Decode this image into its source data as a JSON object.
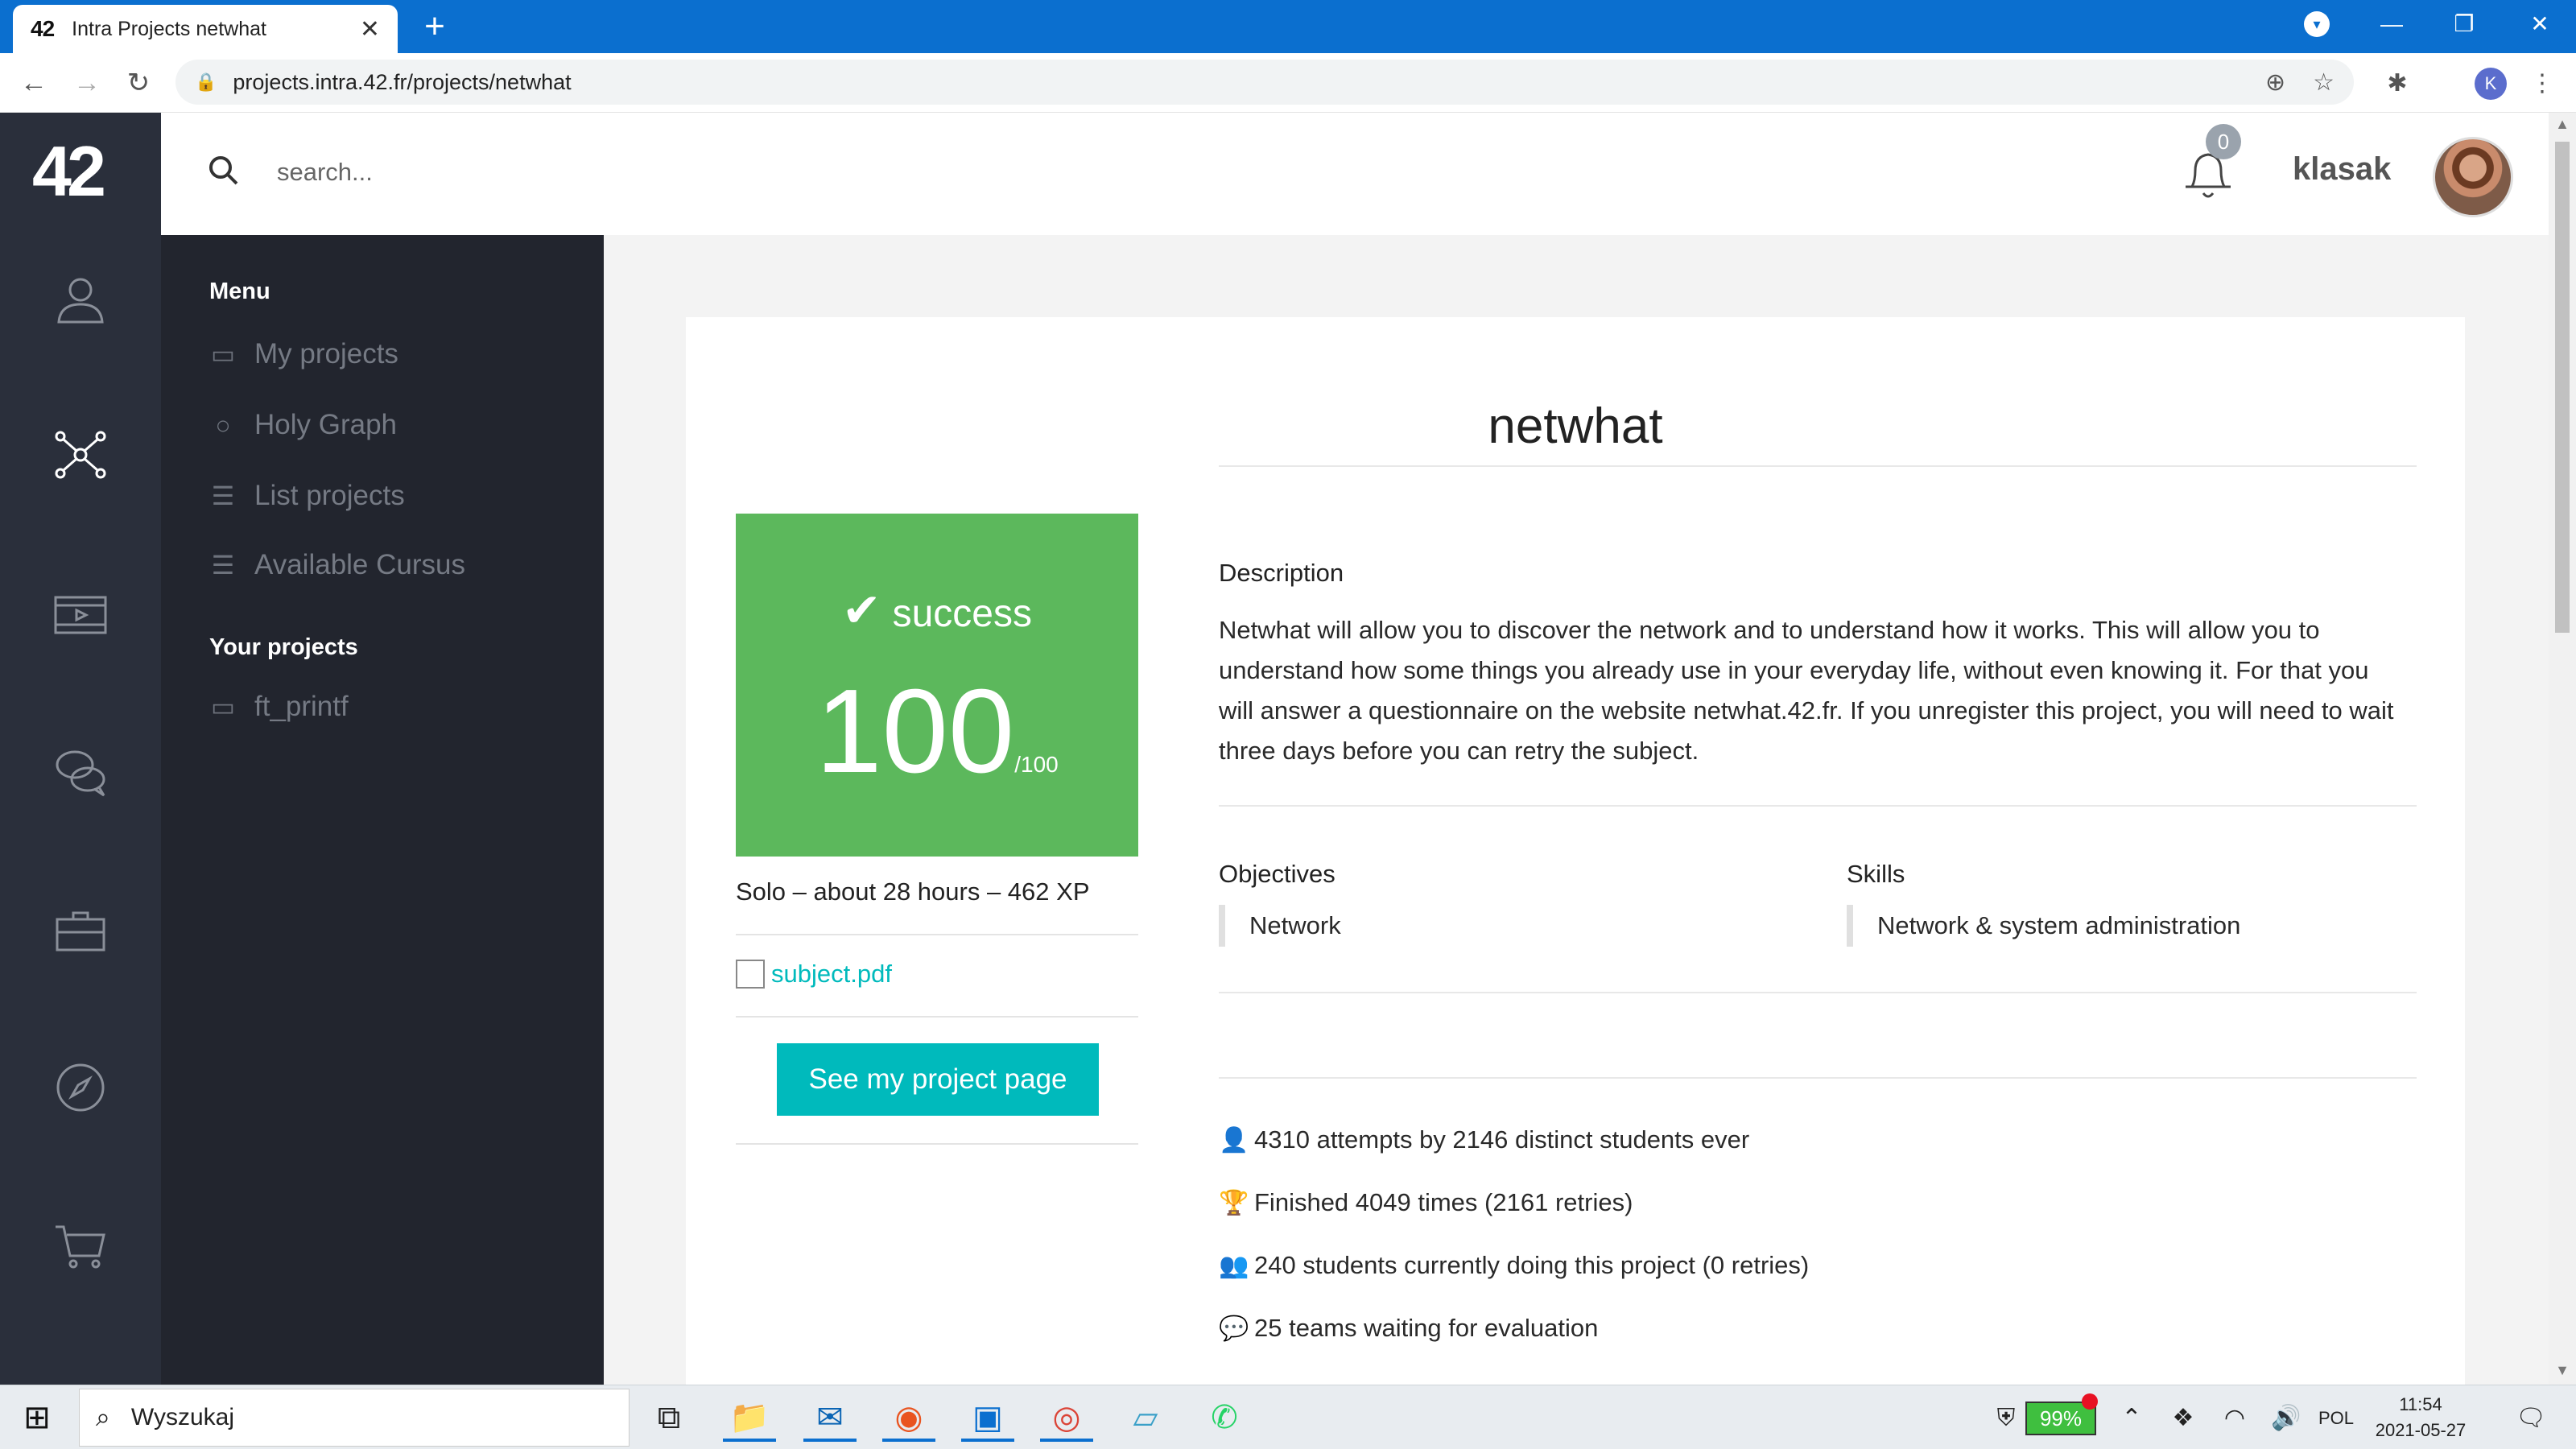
{
  "browser": {
    "tab_logo": "42",
    "tab_title": "Intra Projects netwhat",
    "tab_close": "✕",
    "new_tab": "+",
    "url": "projects.intra.42.fr/projects/netwhat",
    "profile_initial": "K"
  },
  "app": {
    "logo": "42",
    "search_placeholder": "search...",
    "notifications_count": "0",
    "username": "klasak"
  },
  "menu": {
    "heading": "Menu",
    "items": [
      {
        "label": "My projects",
        "icon": "briefcase-icon"
      },
      {
        "label": "Holy Graph",
        "icon": "globe-icon"
      },
      {
        "label": "List projects",
        "icon": "list-icon"
      },
      {
        "label": "Available Cursus",
        "icon": "list-icon"
      }
    ],
    "your_projects_heading": "Your projects",
    "your_projects": [
      {
        "label": "ft_printf",
        "icon": "folder-icon"
      }
    ]
  },
  "project": {
    "title": "netwhat",
    "status": "success",
    "score": "100",
    "score_max": "/100",
    "meta": "Solo – about 28 hours – 462 XP",
    "subject_link": "subject.pdf",
    "project_page_button": "See my project page",
    "description_label": "Description",
    "description": "Netwhat will allow you to discover the network and to understand how it works. This will allow you to understand how some things you already use in your everyday life, without even knowing it. For that you will answer a questionnaire on the website netwhat.42.fr. If you unregister this project, you will need to wait three days before you can retry the subject.",
    "objectives_label": "Objectives",
    "objectives": [
      "Network"
    ],
    "skills_label": "Skills",
    "skills": [
      "Network & system administration"
    ],
    "stats": [
      {
        "icon": "user-icon",
        "text": "4310 attempts by 2146 distinct students ever"
      },
      {
        "icon": "trophy-icon",
        "text": "Finished 4049 times (2161 retries)"
      },
      {
        "icon": "users-clock-icon",
        "text": "240 students currently doing this project (0 retries)"
      },
      {
        "icon": "chat-icon",
        "text": "25 teams waiting for evaluation"
      }
    ]
  },
  "taskbar": {
    "search_text": "Wyszukaj",
    "battery": "99%",
    "language": "POL",
    "time": "11:54",
    "date": "2021-05-27"
  },
  "colors": {
    "success": "#5cb85c",
    "accent": "#00babc",
    "rail": "#2a2f3b",
    "menu": "#22252e",
    "titlebar": "#0b6fcf"
  }
}
